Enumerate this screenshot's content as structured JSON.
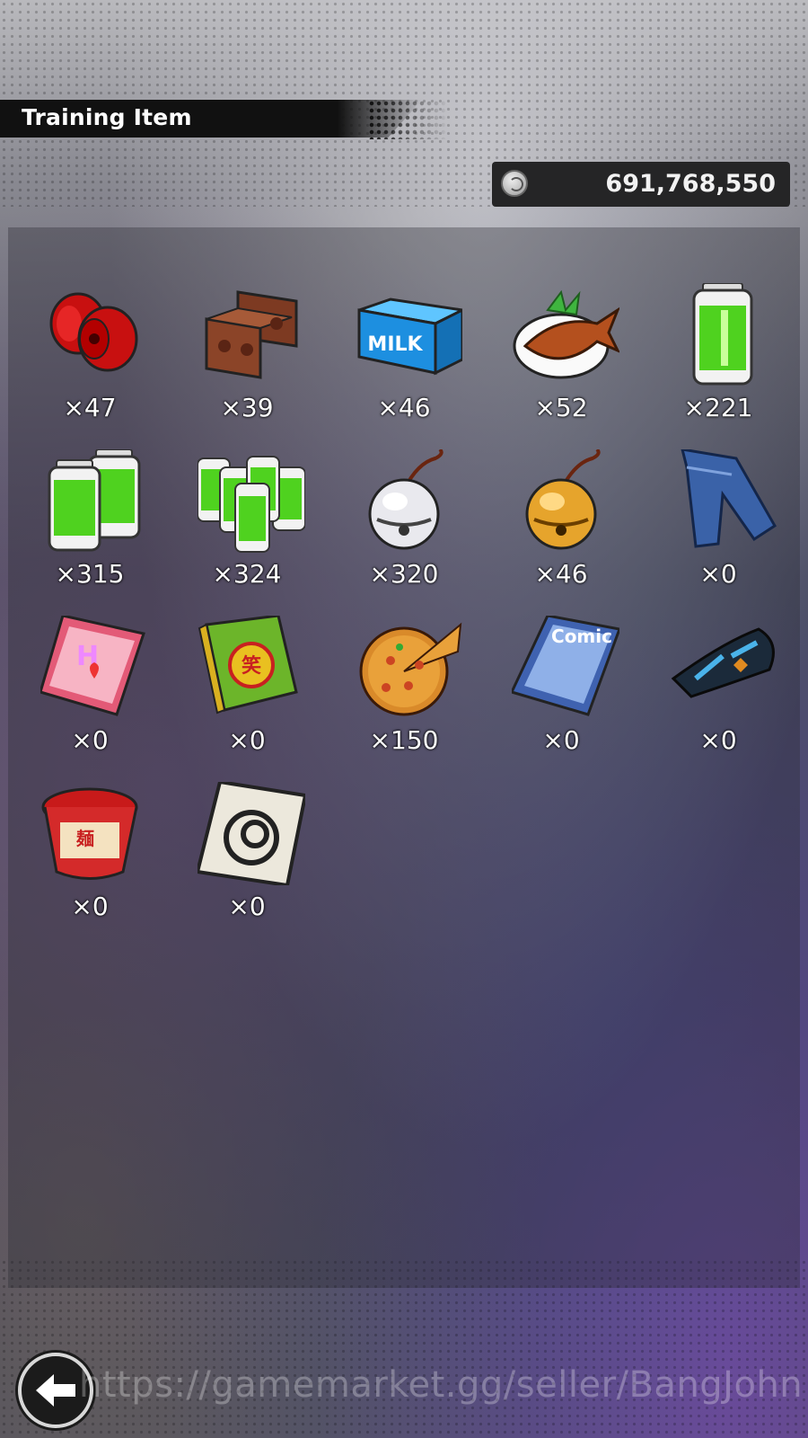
{
  "header": {
    "title": "Training Item"
  },
  "currency": {
    "icon": "coin-icon",
    "value": "691,768,550"
  },
  "items": [
    {
      "name": "dumbbell",
      "count": "×47"
    },
    {
      "name": "bricks",
      "count": "×39"
    },
    {
      "name": "milk",
      "count": "×46"
    },
    {
      "name": "grilled-fish",
      "count": "×52"
    },
    {
      "name": "battery-single",
      "count": "×221"
    },
    {
      "name": "battery-double",
      "count": "×315"
    },
    {
      "name": "battery-pack",
      "count": "×324"
    },
    {
      "name": "silver-bell",
      "count": "×320"
    },
    {
      "name": "gold-bell",
      "count": "×46"
    },
    {
      "name": "jeans",
      "count": "×0"
    },
    {
      "name": "romance-book",
      "count": "×0"
    },
    {
      "name": "joke-book",
      "count": "×0"
    },
    {
      "name": "pizza",
      "count": "×150"
    },
    {
      "name": "comic-book",
      "count": "×0"
    },
    {
      "name": "wristband",
      "count": "×0"
    },
    {
      "name": "ramen-cup",
      "count": "×0"
    },
    {
      "name": "capsule-card",
      "count": "×0"
    }
  ],
  "footer": {
    "back_icon": "arrow-left-icon",
    "watermark": "https://gamemarket.gg/seller/BangJohn"
  },
  "colors": {
    "accent": "#111111",
    "panel": "#252526"
  }
}
